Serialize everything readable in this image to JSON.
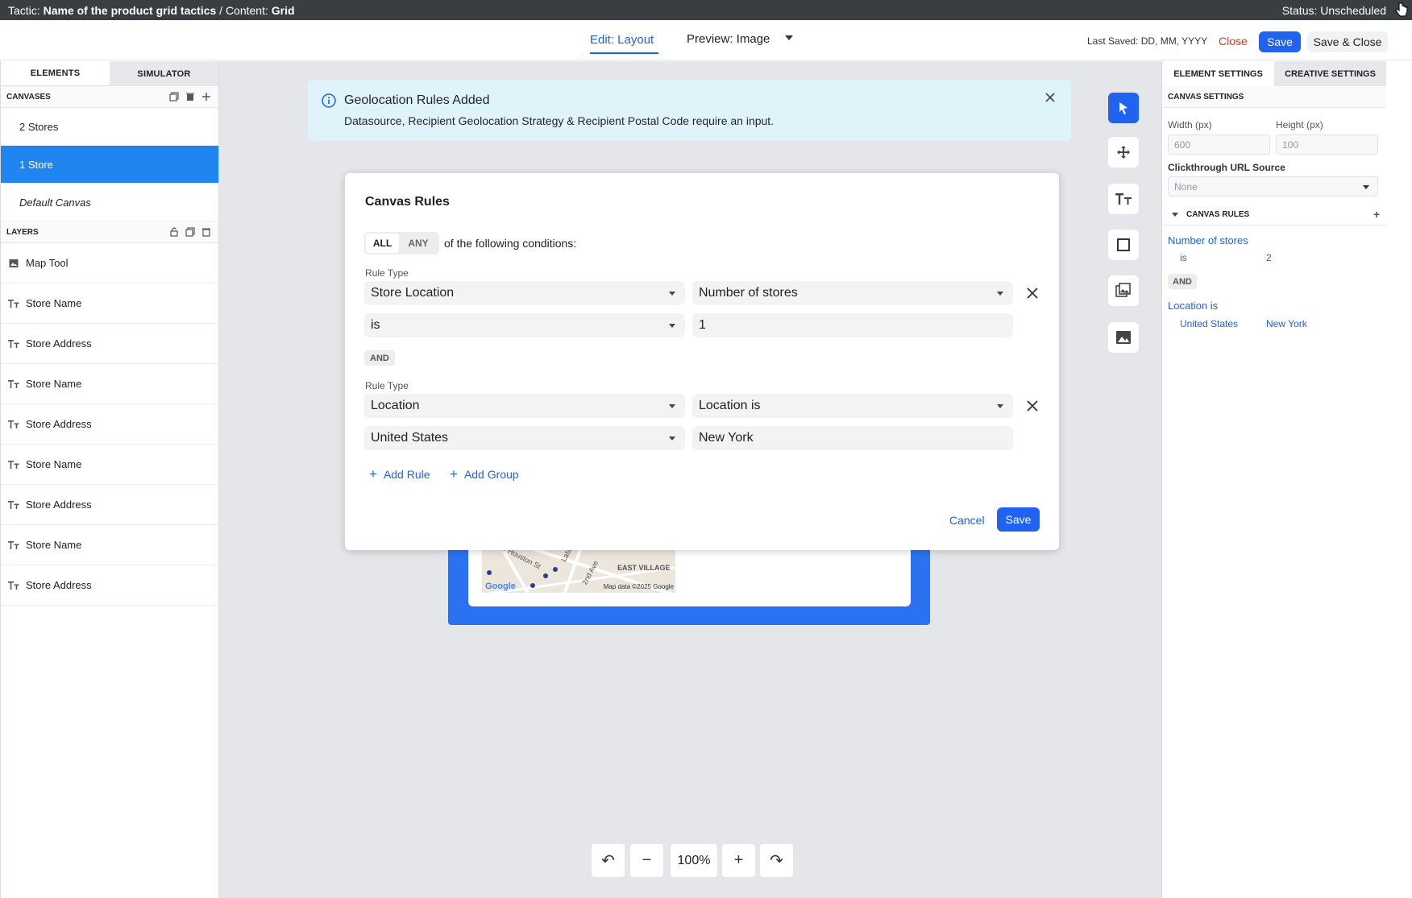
{
  "topbar": {
    "tactic_prefix": "Tactic:",
    "tactic_name": "Name of the product grid tactics",
    "content_prefix": "/ Content:",
    "content_name": "Grid",
    "status": "Status: Unscheduled"
  },
  "header": {
    "edit_tab": "Edit: Layout",
    "preview": "Preview: Image",
    "last_saved": "Last Saved: DD, MM, YYYY",
    "close": "Close",
    "save": "Save",
    "save_close": "Save & Close"
  },
  "left_panel": {
    "tabs": [
      "ELEMENTS",
      "SIMULATOR"
    ],
    "canvases_title": "CANVASES",
    "canvases": [
      "2 Stores",
      "1 Store",
      "Default Canvas"
    ],
    "layers_title": "LAYERS",
    "layers": [
      {
        "label": "Map Tool",
        "icon": "image-icon"
      },
      {
        "label": "Store Name",
        "icon": "text-icon"
      },
      {
        "label": "Store Address",
        "icon": "text-icon"
      },
      {
        "label": "Store Name",
        "icon": "text-icon"
      },
      {
        "label": "Store Address",
        "icon": "text-icon"
      },
      {
        "label": "Store Name",
        "icon": "text-icon"
      },
      {
        "label": "Store Address",
        "icon": "text-icon"
      },
      {
        "label": "Store Name",
        "icon": "text-icon"
      },
      {
        "label": "Store Address",
        "icon": "text-icon"
      }
    ]
  },
  "banner": {
    "title": "Geolocation Rules Added",
    "message": "Datasource, Recipient Geolocation Strategy & Recipient Postal Code require an input."
  },
  "map": {
    "labels": [
      "W Houston St",
      "Lafa",
      "2nd Ave",
      "EAST VILLAGE"
    ],
    "google": "Google",
    "attribution": "Map data ©2025 Google"
  },
  "modal": {
    "title": "Canvas Rules",
    "toggle": [
      "ALL",
      "ANY"
    ],
    "conditions_text": "of the following conditions:",
    "rule_type_label": "Rule Type",
    "rules": [
      {
        "type": "Store Location",
        "field": "Number of stores",
        "operator": "is",
        "value": "1"
      },
      {
        "type": "Location",
        "field": "Location is",
        "operator": "United States",
        "value": "New York"
      }
    ],
    "and_label": "AND",
    "add_rule": "Add Rule",
    "add_group": "Add Group",
    "cancel": "Cancel",
    "save": "Save"
  },
  "zoom": {
    "value": "100%"
  },
  "right_panel": {
    "tabs": [
      "ELEMENT SETTINGS",
      "CREATIVE SETTINGS"
    ],
    "canvas_settings_title": "CANVAS SETTINGS",
    "width_label": "Width (px)",
    "height_label": "Height (px)",
    "width_value": "600",
    "height_value": "100",
    "clickthrough_label": "Clickthrough URL Source",
    "clickthrough_value": "None",
    "canvas_rules_title": "CANVAS RULES",
    "rule1_name": "Number of stores",
    "rule1_op": "is",
    "rule1_value": "2",
    "and_label": "AND",
    "rule2_name": "Location is",
    "rule2_country": "United States",
    "rule2_city": "New York"
  },
  "colors": {
    "accent": "#1f63f0",
    "selected": "#2185f0",
    "danger": "#d6361f",
    "banner_bg": "#dff3fa"
  }
}
